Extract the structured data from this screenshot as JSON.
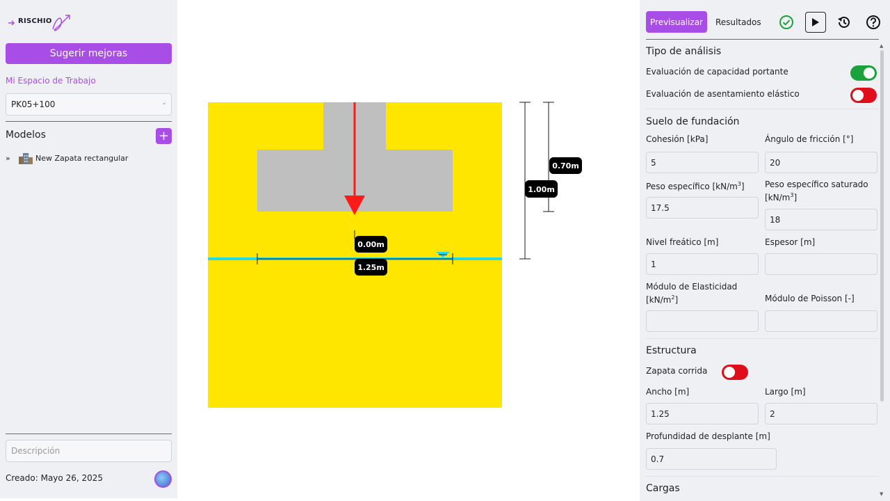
{
  "sidebar": {
    "logo_text": "RISCHIO",
    "suggest_button": "Sugerir mejoras",
    "workspace_label": "Mi Espacio de Trabajo",
    "workspace_selected": "PK05+100",
    "models_title": "Modelos",
    "models": [
      {
        "label": "New Zapata rectangular"
      }
    ],
    "description_placeholder": "Descripción",
    "created_text": "Creado: Mayo 26, 2025"
  },
  "canvas": {
    "dim_depth_label": "0.70m",
    "dim_water_label": "1.00m",
    "dim_zero_label": "0.00m",
    "dim_width_label": "1.25m",
    "colors": {
      "soil": "#ffe600",
      "footing": "#bfbfbf",
      "load_arrow": "#ff1a1a",
      "water_line": "#24d8e6"
    }
  },
  "panel": {
    "tab_preview": "Previsualizar",
    "tab_results": "Resultados",
    "analysis": {
      "title": "Tipo de análisis",
      "bearing_label": "Evaluación de capacidad portante",
      "bearing_on": true,
      "settlement_label": "Evaluación de asentamiento elástico",
      "settlement_on": false
    },
    "soil": {
      "title": "Suelo de fundación",
      "cohesion_label": "Cohesión [kPa]",
      "cohesion_value": "5",
      "friction_label": "Ángulo de fricción [°]",
      "friction_value": "20",
      "unit_weight_label": "Peso específico [kN/m",
      "unit_weight_value": "17.5",
      "sat_weight_label_1": "Peso específico saturado",
      "sat_weight_label_2": "[kN/m",
      "sat_weight_value": "18",
      "water_table_label": "Nivel freático [m]",
      "water_table_value": "1",
      "thickness_label": "Espesor [m]",
      "thickness_value": "",
      "elastic_label_1": "Módulo de Elasticidad",
      "elastic_label_2": "[kN/m",
      "elastic_value": "",
      "poisson_label": "Módulo de Poisson [-]",
      "poisson_value": ""
    },
    "structure": {
      "title": "Estructura",
      "strip_label": "Zapata corrida",
      "strip_on": false,
      "width_label": "Ancho [m]",
      "width_value": "1.25",
      "length_label": "Largo [m]",
      "length_value": "2",
      "depth_label": "Profundidad de desplante [m]",
      "depth_value": "0.7"
    },
    "loads": {
      "title": "Cargas"
    }
  }
}
